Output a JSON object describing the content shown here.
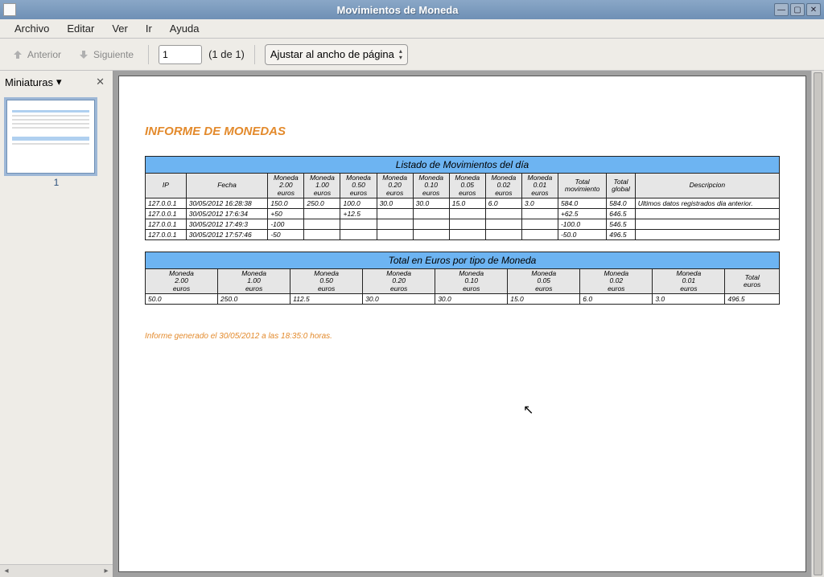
{
  "window": {
    "title": "Movimientos de Moneda"
  },
  "menu": {
    "file": "Archivo",
    "edit": "Editar",
    "view": "Ver",
    "go": "Ir",
    "help": "Ayuda"
  },
  "toolbar": {
    "prev": "Anterior",
    "next": "Siguiente",
    "page_value": "1",
    "page_of": "(1 de 1)",
    "zoom": "Ajustar al ancho de página"
  },
  "sidebar": {
    "header": "Miniaturas",
    "thumb_number": "1"
  },
  "report": {
    "title": "INFORME DE MONEDAS",
    "table1": {
      "caption": "Listado de Movimientos del día",
      "headers": [
        "IP",
        "Fecha",
        "Moneda 2.00 euros",
        "Moneda 1.00 euros",
        "Moneda 0.50 euros",
        "Moneda 0.20 euros",
        "Moneda 0.10 euros",
        "Moneda 0.05 euros",
        "Moneda 0.02 euros",
        "Moneda 0.01 euros",
        "Total movimiento",
        "Total global",
        "Descripcion"
      ],
      "rows": [
        [
          "127.0.0.1",
          "30/05/2012 16:28:38",
          "150.0",
          "250.0",
          "100.0",
          "30.0",
          "30.0",
          "15.0",
          "6.0",
          "3.0",
          "584.0",
          "584.0",
          "Ultimos datos registrados dia anterior."
        ],
        [
          "127.0.0.1",
          "30/05/2012 17:6:34",
          "+50",
          "",
          "+12.5",
          "",
          "",
          "",
          "",
          "",
          "+62.5",
          "646.5",
          ""
        ],
        [
          "127.0.0.1",
          "30/05/2012 17:49:3",
          "-100",
          "",
          "",
          "",
          "",
          "",
          "",
          "",
          "-100.0",
          "546.5",
          ""
        ],
        [
          "127.0.0.1",
          "30/05/2012 17:57:46",
          "-50",
          "",
          "",
          "",
          "",
          "",
          "",
          "",
          "-50.0",
          "496.5",
          ""
        ]
      ]
    },
    "table2": {
      "caption": "Total en Euros por tipo de Moneda",
      "headers": [
        "Moneda 2.00 euros",
        "Moneda 1.00 euros",
        "Moneda 0.50 euros",
        "Moneda 0.20 euros",
        "Moneda 0.10 euros",
        "Moneda 0.05 euros",
        "Moneda 0.02 euros",
        "Moneda 0.01 euros",
        "Total euros"
      ],
      "rows": [
        [
          "50.0",
          "250.0",
          "112.5",
          "30.0",
          "30.0",
          "15.0",
          "6.0",
          "3.0",
          "496.5"
        ]
      ]
    },
    "footer": "Informe generado el 30/05/2012 a las 18:35:0 horas."
  }
}
